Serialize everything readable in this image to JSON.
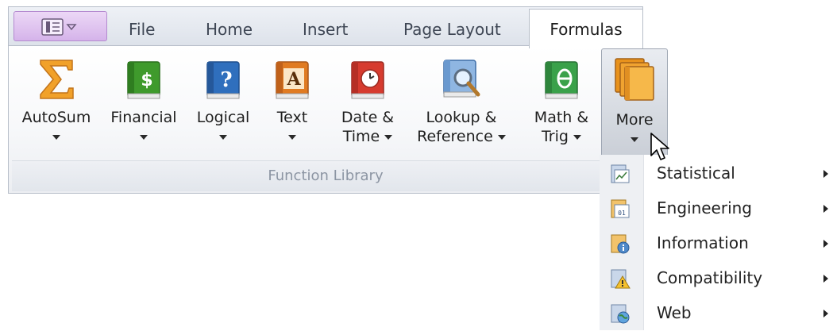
{
  "tabs": {
    "file": "File",
    "home": "Home",
    "insert": "Insert",
    "page_layout": "Page Layout",
    "formulas": "Formulas"
  },
  "group": {
    "name": "Function Library"
  },
  "buttons": {
    "autosum": {
      "label": "AutoSum",
      "icon": "sigma-icon"
    },
    "financial": {
      "label": "Financial",
      "icon": "financial-book-icon"
    },
    "logical": {
      "label": "Logical",
      "icon": "logical-book-icon"
    },
    "text": {
      "label": "Text",
      "icon": "text-book-icon"
    },
    "datetime": {
      "line1": "Date &",
      "line2": "Time",
      "icon": "clock-book-icon"
    },
    "lookup": {
      "line1": "Lookup &",
      "line2": "Reference",
      "icon": "magnifier-book-icon"
    },
    "math": {
      "line1": "Math &",
      "line2": "Trig",
      "icon": "theta-book-icon"
    },
    "more": {
      "label": "More",
      "icon": "stacked-books-icon"
    }
  },
  "more_menu": {
    "items": [
      {
        "label": "Statistical",
        "icon": "statistical-icon"
      },
      {
        "label": "Engineering",
        "icon": "engineering-icon"
      },
      {
        "label": "Information",
        "icon": "information-icon"
      },
      {
        "label": "Compatibility",
        "icon": "compatibility-warning-icon"
      },
      {
        "label": "Web",
        "icon": "web-globe-icon"
      }
    ]
  },
  "colors": {
    "app_menu": "#d5b3ea",
    "financial": "#3f9a2c",
    "logical": "#2f6fbd",
    "text": "#e07b22",
    "datetime": "#d63b2f",
    "lookup": "#4f89c9",
    "math": "#3aa14a",
    "more": "#e8921c"
  }
}
